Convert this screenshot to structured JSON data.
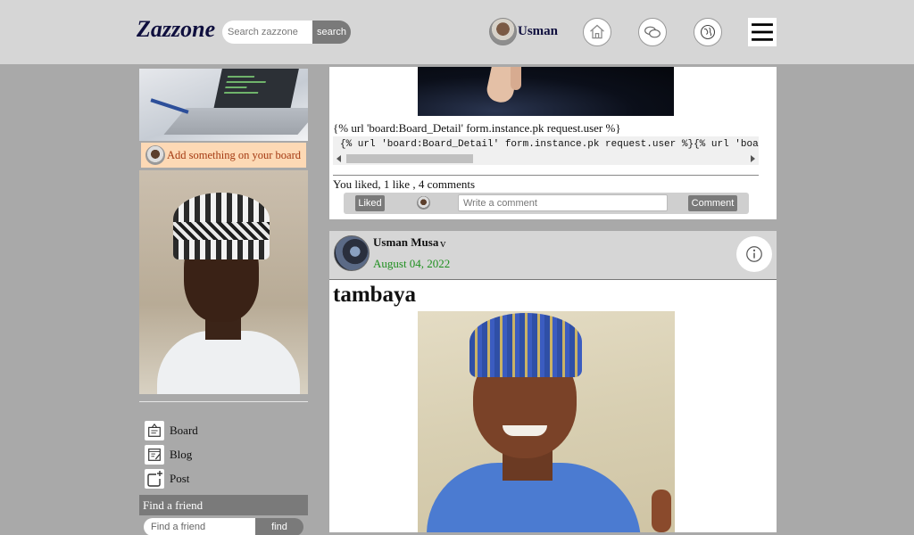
{
  "header": {
    "logo": "Zazzone",
    "search_placeholder": "Search zazzone",
    "search_button": "search",
    "user_name": "Usman"
  },
  "sidebar": {
    "add_board_text": "Add something on your board",
    "nav": [
      {
        "label": "Board",
        "icon": "board-icon"
      },
      {
        "label": "Blog",
        "icon": "blog-icon"
      },
      {
        "label": "Post",
        "icon": "post-icon"
      }
    ],
    "find_friend_heading": "Find a friend",
    "find_friend_placeholder": "Find a friend",
    "find_button": "find"
  },
  "feed": {
    "card1": {
      "url_text": "{% url 'board:Board_Detail' form.instance.pk request.user %}",
      "code_text": "{% url 'board:Board_Detail' form.instance.pk request.user %}{% url 'board:Board_Detail' form.instance.pk request.user %}",
      "stats": "You liked, 1 like , 4 comments",
      "liked_button": "Liked",
      "comment_placeholder": "Write a comment",
      "comment_button": "Comment"
    },
    "card2": {
      "author": "Usman Musa",
      "author_suffix": "v",
      "date": "August 04, 2022",
      "title": "tambaya"
    }
  }
}
